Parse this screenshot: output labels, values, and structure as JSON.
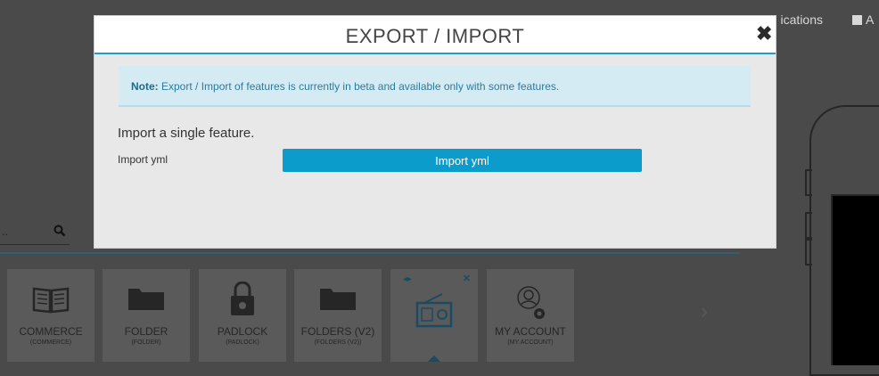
{
  "background": {
    "header": {
      "notifications_text": "ications",
      "account_text": "A"
    },
    "search": {
      "placeholder_fragment": "..",
      "icon": "search-icon"
    },
    "tiles": [
      {
        "label": "COMMERCE",
        "sub": "(COMMERCE)",
        "icon": "book-icon"
      },
      {
        "label": "FOLDER",
        "sub": "(FOLDER)",
        "icon": "folder-icon"
      },
      {
        "label": "PADLOCK",
        "sub": "(PADLOCK)",
        "icon": "padlock-icon"
      },
      {
        "label": "FOLDERS (V2)",
        "sub": "(FOLDERS (V2))",
        "icon": "folder-icon"
      },
      {
        "label": "",
        "sub": "",
        "icon": "radio-icon"
      },
      {
        "label": "MY ACCOUNT",
        "sub": "(MY ACCOUNT)",
        "icon": "account-settings-icon"
      }
    ],
    "next_glyph": "›"
  },
  "modal": {
    "title": "EXPORT / IMPORT",
    "close_glyph": "✖",
    "note": {
      "label": "Note:",
      "text": " Export / Import of features is currently in beta and available only with some features."
    },
    "section_title": "Import a single feature.",
    "field_label": "Import yml",
    "import_button_label": "Import yml"
  },
  "colors": {
    "accent": "#0b9ccc",
    "header_underline": "#1aa0c8",
    "note_bg": "#d4ebf3",
    "note_text": "#2e7a9c",
    "overlay_bg": "#4a4a4a"
  }
}
